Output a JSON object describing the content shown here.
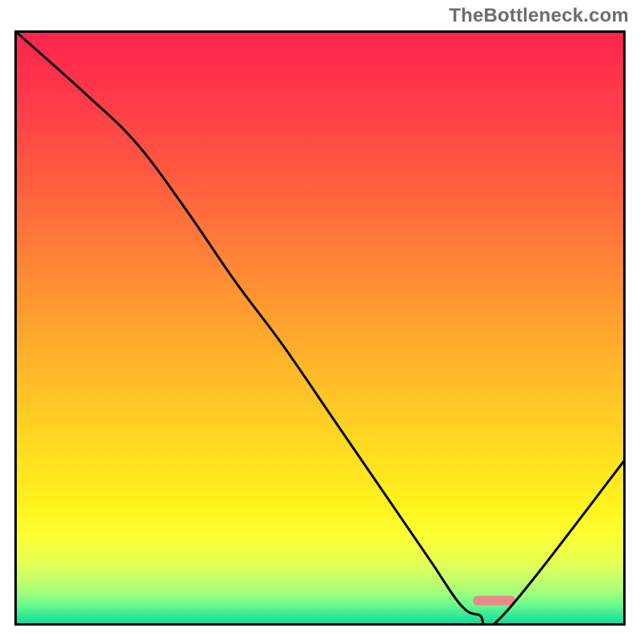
{
  "watermark": "TheBottleneck.com",
  "chart_data": {
    "type": "line",
    "title": "",
    "xlabel": "",
    "ylabel": "",
    "xlim": [
      0,
      100
    ],
    "ylim": [
      0,
      100
    ],
    "grid": false,
    "series": [
      {
        "name": "curve",
        "x": [
          0,
          12,
          20,
          28,
          36,
          44,
          52,
          60,
          68,
          73,
          76,
          80,
          100
        ],
        "values": [
          100,
          89,
          81,
          70,
          58,
          47,
          35,
          23,
          11,
          3.5,
          1.8,
          1.8,
          28
        ]
      }
    ],
    "marker": {
      "x_start": 75,
      "x_end": 82,
      "y": 4.2,
      "color": "#e98a8a"
    },
    "background": {
      "type": "vertical-gradient",
      "stops": [
        {
          "pos": 0.0,
          "color": "#ff234f"
        },
        {
          "pos": 0.14,
          "color": "#ff4048"
        },
        {
          "pos": 0.28,
          "color": "#ff653e"
        },
        {
          "pos": 0.42,
          "color": "#ff8d34"
        },
        {
          "pos": 0.56,
          "color": "#ffb52a"
        },
        {
          "pos": 0.7,
          "color": "#ffdb21"
        },
        {
          "pos": 0.8,
          "color": "#fff41c"
        },
        {
          "pos": 0.85,
          "color": "#fbff33"
        },
        {
          "pos": 0.89,
          "color": "#e8ff52"
        },
        {
          "pos": 0.92,
          "color": "#c8ff6a"
        },
        {
          "pos": 0.945,
          "color": "#a0ff7d"
        },
        {
          "pos": 0.965,
          "color": "#6cfa8c"
        },
        {
          "pos": 0.985,
          "color": "#2be89a"
        },
        {
          "pos": 1.0,
          "color": "#0cd69d"
        }
      ]
    },
    "frame_color": "#000000",
    "line_color": "#000000",
    "line_width": 3
  }
}
